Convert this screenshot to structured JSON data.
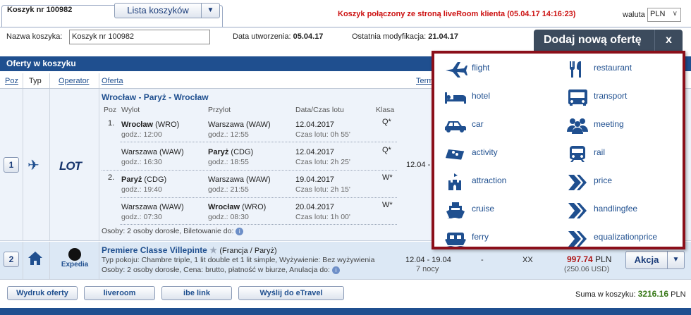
{
  "basket": {
    "tab_title": "Koszyk nr 100982",
    "list_button": "Lista koszyków",
    "connected_notice": "Koszyk połączony ze stroną liveRoom klienta (05.04.17 14:16:23)",
    "currency_label": "waluta",
    "currency_value": "PLN",
    "name_label": "Nazwa koszyka:",
    "name_value": "Koszyk nr 100982",
    "created_label": "Data utworzenia:",
    "created_value": "05.04.17",
    "modified_label": "Ostatnia modyfikacja:",
    "modified_value": "21.04.17"
  },
  "add_offer": {
    "title": "Dodaj nową ofertę",
    "close": "x",
    "items": [
      {
        "label": "flight",
        "icon": "plane-icon"
      },
      {
        "label": "restaurant",
        "icon": "cutlery-icon"
      },
      {
        "label": "hotel",
        "icon": "bed-icon"
      },
      {
        "label": "transport",
        "icon": "bus-icon"
      },
      {
        "label": "car",
        "icon": "car-icon"
      },
      {
        "label": "meeting",
        "icon": "people-icon"
      },
      {
        "label": "activity",
        "icon": "ticket-icon"
      },
      {
        "label": "rail",
        "icon": "train-icon"
      },
      {
        "label": "attraction",
        "icon": "castle-icon"
      },
      {
        "label": "price",
        "icon": "arrow-icon"
      },
      {
        "label": "cruise",
        "icon": "ship-icon"
      },
      {
        "label": "handlingfee",
        "icon": "arrow-icon"
      },
      {
        "label": "ferry",
        "icon": "ferry-icon"
      },
      {
        "label": "equalizationprice",
        "icon": "arrow-icon"
      }
    ]
  },
  "section_title": "Oferty w koszyku",
  "columns": {
    "poz": "Poz",
    "typ": "Typ",
    "operator": "Operator",
    "oferta": "Oferta",
    "term": "Term"
  },
  "row1": {
    "poz": "1",
    "operator": "LOT",
    "route": "Wrocław - Paryż - Wrocław",
    "headers": {
      "poz": "Poz",
      "wylot": "Wylot",
      "przylot": "Przylot",
      "data": "Data/Czas lotu",
      "klasa": "Klasa"
    },
    "segments": [
      {
        "num": "1.",
        "from": "Wrocław",
        "from_code": "(WRO)",
        "dep": "godz.: 12:00",
        "to": "Warszawa (WAW)",
        "arr": "godz.: 12:55",
        "date": "12.04.2017",
        "dur": "Czas lotu: 0h 55'",
        "cls": "Q*"
      },
      {
        "num": "",
        "from": "Warszawa (WAW)",
        "from_code": "",
        "dep": "godz.: 16:30",
        "to": "Paryż",
        "to_code": "(CDG)",
        "arr": "godz.: 18:55",
        "date": "12.04.2017",
        "dur": "Czas lotu: 2h 25'",
        "cls": "Q*"
      },
      {
        "num": "2.",
        "from": "Paryż",
        "from_code": "(CDG)",
        "dep": "godz.: 19:40",
        "to": "Warszawa (WAW)",
        "arr": "godz.: 21:55",
        "date": "19.04.2017",
        "dur": "Czas lotu: 2h 15'",
        "cls": "W*"
      },
      {
        "num": "",
        "from": "Warszawa (WAW)",
        "from_code": "",
        "dep": "godz.: 07:30",
        "to": "Wrocław",
        "to_code": "(WRO)",
        "arr": "godz.: 08:30",
        "date": "20.04.2017",
        "dur": "Czas lotu: 1h 00'",
        "cls": "W*"
      }
    ],
    "persons": "Osoby: 2 osoby dorosłe, Biletowanie do:",
    "term": "12.04 -"
  },
  "row2": {
    "poz": "2",
    "operator": "Expedia",
    "hotel": "Premiere Classe Villepinte",
    "location": "(Francja / Paryż)",
    "line1": "Typ pokoju: Chambre triple, 1 lit double et 1 lit simple, Wyżywienie: Bez wyżywienia",
    "line2": "Osoby: 2 osoby dorosłe, Cena: brutto, płatność w biurze, Anulacja do:",
    "term": "12.04 - 19.04",
    "nights": "7 nocy",
    "dash": "-",
    "xx": "XX",
    "price": "997.74",
    "price_cur": "PLN",
    "price_alt": "(250.06 USD)",
    "action": "Akcja"
  },
  "bottom": {
    "buttons": [
      "Wydruk oferty",
      "liveroom",
      "ibe link",
      "Wyślij do eTravel"
    ],
    "sum_label": "Suma w koszyku:",
    "sum_value": "3216.16",
    "sum_cur": "PLN"
  }
}
